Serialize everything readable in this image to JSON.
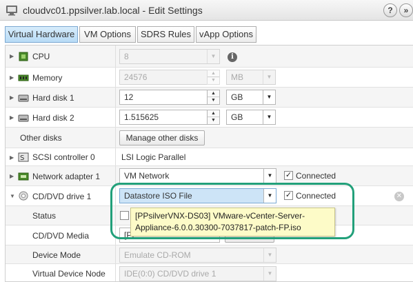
{
  "window": {
    "title": "cloudvc01.ppsilver.lab.local - Edit Settings",
    "help_label": "?",
    "expand_label": "»"
  },
  "tabs": [
    {
      "label": "Virtual Hardware",
      "active": true
    },
    {
      "label": "VM Options",
      "active": false
    },
    {
      "label": "SDRS Rules",
      "active": false
    },
    {
      "label": "vApp Options",
      "active": false
    }
  ],
  "hardware": {
    "cpu": {
      "label": "CPU",
      "value": "8"
    },
    "memory": {
      "label": "Memory",
      "value": "24576",
      "unit": "MB"
    },
    "hard_disk_1": {
      "label": "Hard disk 1",
      "value": "12",
      "unit": "GB"
    },
    "hard_disk_2": {
      "label": "Hard disk 2",
      "value": "1.515625",
      "unit": "GB"
    },
    "other_disks": {
      "label": "Other disks",
      "button": "Manage other disks"
    },
    "scsi": {
      "label": "SCSI controller 0",
      "value": "LSI Logic Parallel"
    },
    "network": {
      "label": "Network adapter 1",
      "value": "VM Network",
      "connected_label": "Connected",
      "connected": true
    },
    "cddvd": {
      "label": "CD/DVD drive 1",
      "value": "Datastore ISO File",
      "connected_label": "Connected",
      "connected": true,
      "status_label": "Status",
      "media_label": "CD/DVD Media",
      "media_value": "[PP",
      "device_mode_label": "Device Mode",
      "device_mode_value": "Emulate CD-ROM",
      "vdn_label": "Virtual Device Node",
      "vdn_value": "IDE(0:0) CD/DVD drive 1"
    }
  },
  "tooltip": {
    "line1": "[PPsilverVNX-DS03] VMware-vCenter-Server-",
    "line2": "Appliance-6.0.0.30300-7037817-patch-FP.iso"
  },
  "colors": {
    "highlight": "#22a07a",
    "active_tab": "#b8dbf6",
    "tooltip_bg": "#fdfbc8"
  }
}
